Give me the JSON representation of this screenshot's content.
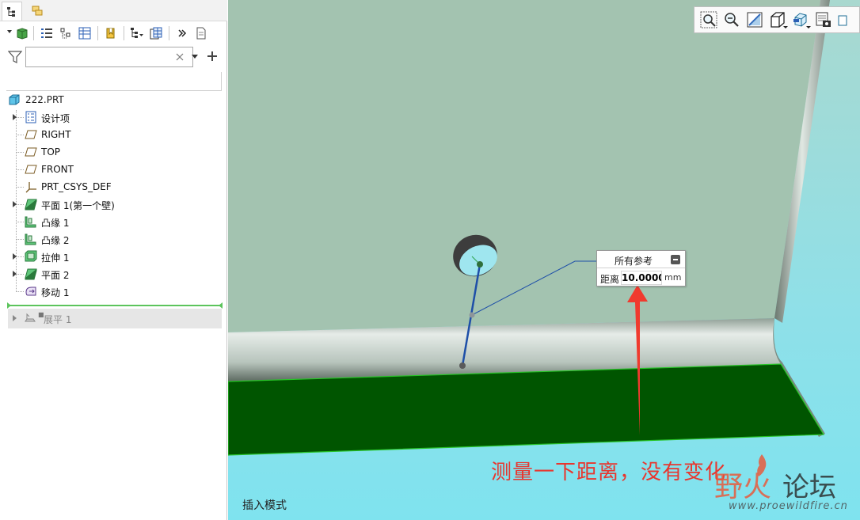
{
  "model_tree": {
    "filter_placeholder": "",
    "root": {
      "label": "222.PRT"
    },
    "items": [
      {
        "label": "设计项",
        "expandable": true,
        "icon": "design-items-icon"
      },
      {
        "label": "RIGHT",
        "expandable": false,
        "icon": "datum-plane-icon"
      },
      {
        "label": "TOP",
        "expandable": false,
        "icon": "datum-plane-icon"
      },
      {
        "label": "FRONT",
        "expandable": false,
        "icon": "datum-plane-icon"
      },
      {
        "label": "PRT_CSYS_DEF",
        "expandable": false,
        "icon": "csys-icon"
      },
      {
        "label": "平面 1(第一个壁)",
        "expandable": true,
        "icon": "planar-wall-icon"
      },
      {
        "label": "凸缘 1",
        "expandable": false,
        "icon": "flange-icon"
      },
      {
        "label": "凸缘 2",
        "expandable": false,
        "icon": "flange-icon"
      },
      {
        "label": "拉伸 1",
        "expandable": true,
        "icon": "extrude-icon"
      },
      {
        "label": "平面 2",
        "expandable": true,
        "icon": "planar-wall-icon"
      },
      {
        "label": "移动 1",
        "expandable": false,
        "icon": "move-icon"
      }
    ],
    "suppressed_item": {
      "label": "展平 1",
      "marker": "■",
      "icon": "flatten-icon"
    }
  },
  "measure_panel": {
    "title": "所有参考",
    "label": "距离",
    "value": "10.0000",
    "unit": "mm"
  },
  "annotation_text": "测量一下距离，没有变化",
  "mode_label": "插入模式",
  "watermark": {
    "cn_part1": "野火",
    "cn_part2": "论坛",
    "url": "www.proewildfire.cn"
  },
  "colors": {
    "accent_green": "#5cc45c",
    "annotation_red": "#e8362e",
    "arrow_red": "#f03a2e",
    "sheet_face": "#a3c3b0",
    "flat_face": "#005500",
    "background_cyan": "#7fe3ef"
  }
}
